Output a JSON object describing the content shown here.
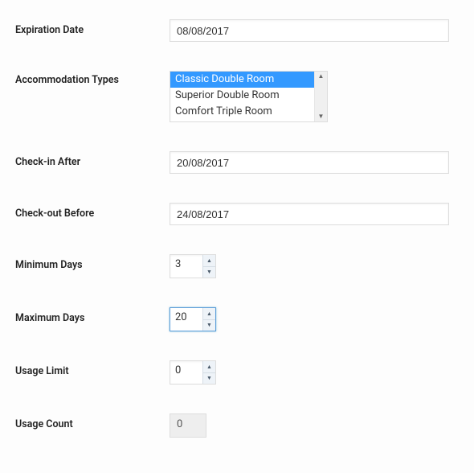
{
  "labels": {
    "expiration_date": "Expiration Date",
    "accommodation_types": "Accommodation Types",
    "checkin_after": "Check-in After",
    "checkout_before": "Check-out Before",
    "minimum_days": "Minimum Days",
    "maximum_days": "Maximum Days",
    "usage_limit": "Usage Limit",
    "usage_count": "Usage Count"
  },
  "values": {
    "expiration_date": "08/08/2017",
    "checkin_after": "20/08/2017",
    "checkout_before": "24/08/2017",
    "minimum_days": "3",
    "maximum_days": "20",
    "usage_limit": "0",
    "usage_count": "0"
  },
  "accommodation_types": {
    "options": [
      {
        "label": "Classic Double Room",
        "selected": true
      },
      {
        "label": "Superior Double Room",
        "selected": false
      },
      {
        "label": "Comfort Triple Room",
        "selected": false
      }
    ]
  }
}
